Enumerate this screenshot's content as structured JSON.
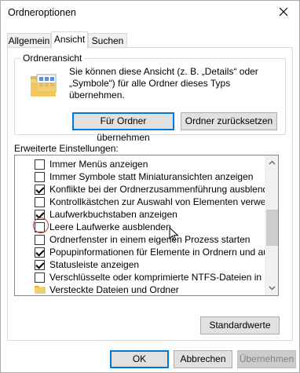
{
  "window": {
    "title": "Ordneroptionen"
  },
  "tabs": [
    {
      "label": "Allgemein",
      "active": false
    },
    {
      "label": "Ansicht",
      "active": true
    },
    {
      "label": "Suchen",
      "active": false
    }
  ],
  "folder_view": {
    "legend": "Ordneransicht",
    "description": "Sie können diese Ansicht (z. B. „Details“ oder „Symbole“) für alle Ordner dieses Typs übernehmen.",
    "apply_button": "Für Ordner übernehmen",
    "reset_button": "Ordner zurücksetzen"
  },
  "advanced": {
    "label": "Erweiterte Einstellungen:",
    "items": [
      {
        "type": "checkbox",
        "checked": false,
        "label": "Immer Menüs anzeigen"
      },
      {
        "type": "checkbox",
        "checked": false,
        "label": "Immer Symbole statt Miniaturansichten anzeigen"
      },
      {
        "type": "checkbox",
        "checked": true,
        "label": "Konflikte bei der Ordnerzusammenführung ausblenden"
      },
      {
        "type": "checkbox",
        "checked": false,
        "label": "Kontrollkästchen zur Auswahl von Elementen verwenden"
      },
      {
        "type": "checkbox",
        "checked": true,
        "label": "Laufwerkbuchstaben anzeigen"
      },
      {
        "type": "checkbox",
        "checked": false,
        "label": "Leere Laufwerke ausblenden"
      },
      {
        "type": "checkbox",
        "checked": false,
        "label": "Ordnerfenster in einem eigenen Prozess starten"
      },
      {
        "type": "checkbox",
        "checked": true,
        "label": "Popupinformationen für Elemente in Ordnern und auf dem D"
      },
      {
        "type": "checkbox",
        "checked": true,
        "label": "Statusleiste anzeigen"
      },
      {
        "type": "checkbox",
        "checked": false,
        "label": "Verschlüsselte oder komprimierte NTFS-Dateien in anderer"
      },
      {
        "type": "folder",
        "label": "Versteckte Dateien und Ordner"
      }
    ]
  },
  "buttons": {
    "defaults": "Standardwerte",
    "ok": "OK",
    "cancel": "Abbrechen",
    "apply": "Übernehmen"
  },
  "colors": {
    "accent": "#0078d7",
    "highlight_circle": "#d23a3a",
    "button_face": "#e1e1e1",
    "scroll_thumb": "#cdcdcd"
  }
}
